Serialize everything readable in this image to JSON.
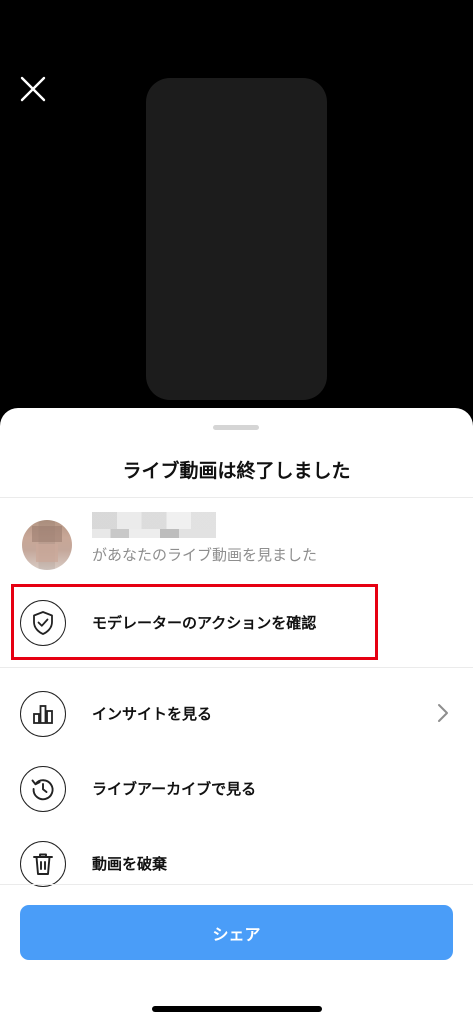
{
  "sheet": {
    "title": "ライブ動画は終了しました"
  },
  "viewer": {
    "text": "があなたのライブ動画を見ました"
  },
  "actions": [
    {
      "label": "モデレーターのアクションを確認",
      "icon": "shield-check-icon",
      "highlighted": true
    },
    {
      "label": "インサイトを見る",
      "icon": "bar-chart-icon",
      "has_chevron": true
    },
    {
      "label": "ライブアーカイブで見る",
      "icon": "history-icon"
    },
    {
      "label": "動画を破棄",
      "icon": "trash-icon"
    }
  ],
  "share": {
    "label": "シェア"
  },
  "colors": {
    "share_button": "#4a9df8",
    "highlight_border": "#e60012"
  }
}
